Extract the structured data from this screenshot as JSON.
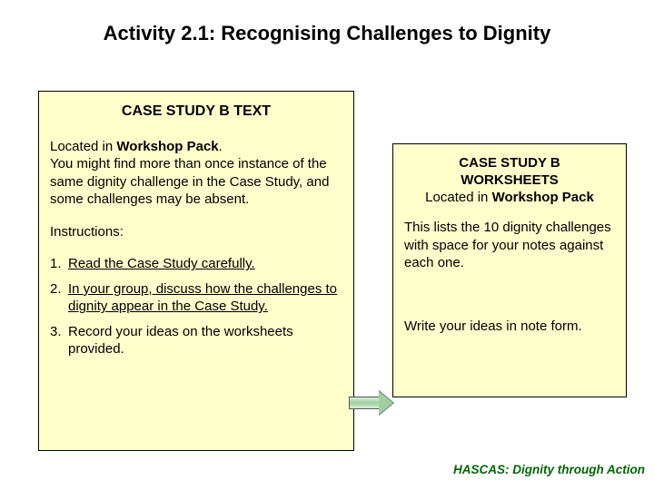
{
  "title": "Activity 2.1:  Recognising Challenges to Dignity",
  "left": {
    "heading": "CASE STUDY B TEXT",
    "located_prefix": "Located in ",
    "located_bold": "Workshop Pack",
    "located_suffix": ".",
    "para": "You might find more than once instance of the same dignity challenge in the Case Study, and some challenges may be absent.",
    "instructions_label": "Instructions:",
    "steps": [
      {
        "num": "1.",
        "text": "Read the Case Study carefully.",
        "underline": true
      },
      {
        "num": "2.",
        "text": "In your group, discuss how the challenges to dignity appear in the Case Study.",
        "underline": true
      },
      {
        "num": "3.",
        "text": "Record your ideas on the worksheets provided.",
        "underline": false
      }
    ]
  },
  "right": {
    "heading_line1": "CASE STUDY B",
    "heading_line2": "WORKSHEETS",
    "heading_prefix": "Located in ",
    "heading_bold": "Workshop Pack",
    "desc": "This lists the 10 dignity challenges with space for your notes against each one.",
    "write": "Write your ideas in note form."
  },
  "footer": "HASCAS: Dignity through Action"
}
